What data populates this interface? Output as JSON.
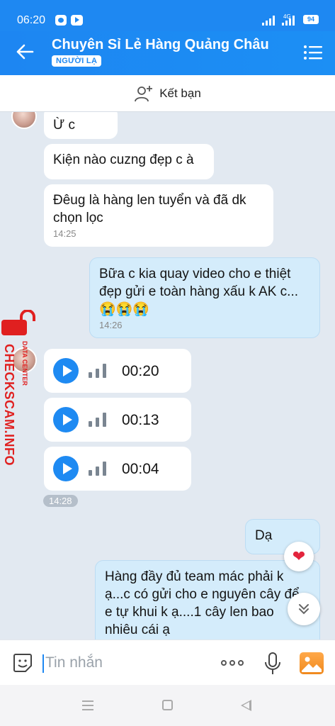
{
  "status_bar": {
    "time": "06:20",
    "network": "4G",
    "battery": "94"
  },
  "header": {
    "title": "Chuyên Sỉ Lẻ Hàng Quảng Châu",
    "badge": "NGƯỜI LẠ"
  },
  "add_friend": {
    "label": "Kết bạn"
  },
  "messages": [
    {
      "side": "in",
      "text": "Ừ c"
    },
    {
      "side": "in",
      "text": "Kiện nào cuzng đẹp c à"
    },
    {
      "side": "in",
      "text": "Đêug là hàng len tuyển và đã dk chọn lọc",
      "time": "14:25"
    },
    {
      "side": "out",
      "text": "Bữa c kia quay video cho e thiệt đẹp gửi e toàn hàng xấu k AK c...😭😭😭",
      "time": "14:26"
    },
    {
      "side": "in",
      "type": "voice",
      "duration": "00:20"
    },
    {
      "side": "in",
      "type": "voice",
      "duration": "00:13"
    },
    {
      "side": "in",
      "type": "voice",
      "duration": "00:04"
    },
    {
      "side": "out",
      "text": "Dạ"
    },
    {
      "side": "out",
      "text": "Hàng đầy đủ team mác phải k ạ...c có gửi cho e nguyên cây để e tự khui k ạ....1 cây len bao nhiêu cái ạ"
    }
  ],
  "voice_group_time": "14:28",
  "reaction": "❤",
  "watermark": {
    "main": "CHECKSCAM.INFO",
    "sub": "DATA CENTER"
  },
  "input": {
    "placeholder": "Tin nhắn"
  },
  "colors": {
    "brand": "#1e88f2",
    "incoming_bubble": "#ffffff",
    "outgoing_bubble": "#d4ecfb",
    "chat_background": "#e2e9f1"
  },
  "icons": [
    "back-arrow-icon",
    "menu-list-icon",
    "add-user-icon",
    "play-icon",
    "heart-icon",
    "chevron-double-down-icon",
    "sticker-icon",
    "more-icon",
    "mic-icon",
    "image-icon"
  ]
}
